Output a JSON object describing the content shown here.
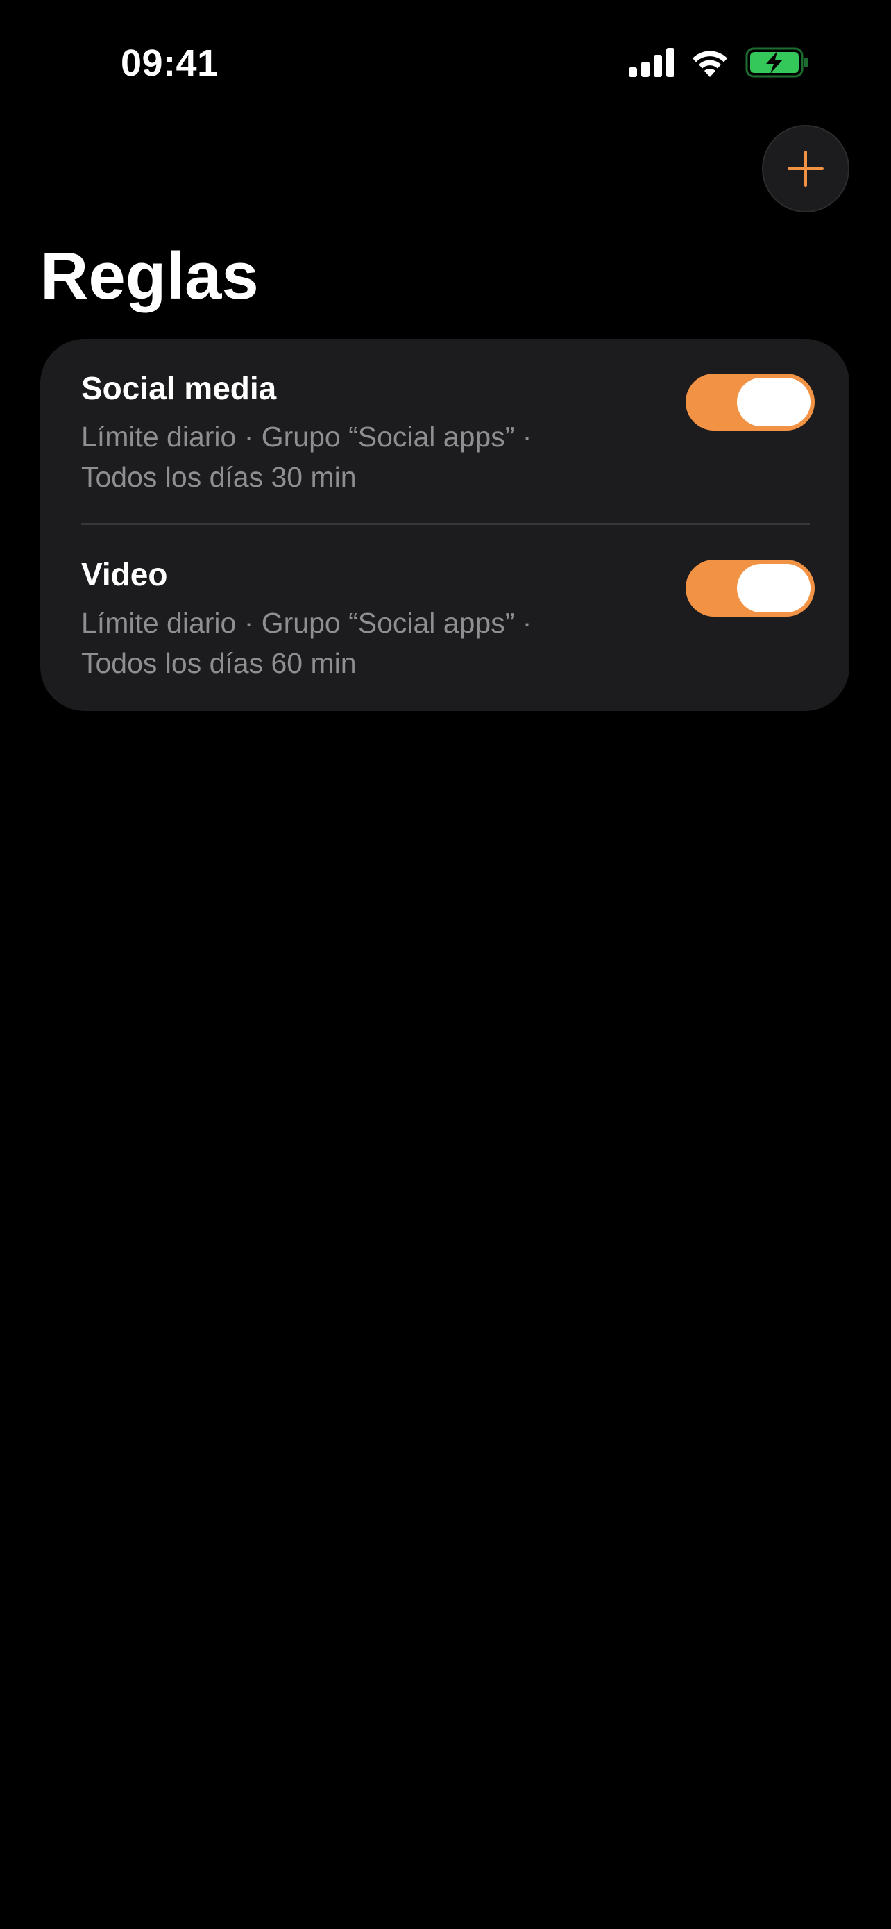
{
  "status_bar": {
    "time": "09:41",
    "icons": [
      "signal-icon",
      "wifi-icon",
      "battery-charging-icon"
    ],
    "battery_color": "#34c759"
  },
  "header": {
    "add_button_icon": "plus-icon",
    "title": "Reglas"
  },
  "rules": [
    {
      "name": "Social media",
      "desc_line1": "Límite diario · Grupo “Social apps” ·",
      "desc_line2": "Todos los días 30 min",
      "enabled": true
    },
    {
      "name": "Video",
      "desc_line1": "Límite diario · Grupo “Social apps” ·",
      "desc_line2": "Todos los días 60 min",
      "enabled": true
    }
  ],
  "colors": {
    "accent": "#f19244",
    "background": "#000000",
    "card": "#1c1c1e",
    "secondary_text": "#8e8e93"
  }
}
